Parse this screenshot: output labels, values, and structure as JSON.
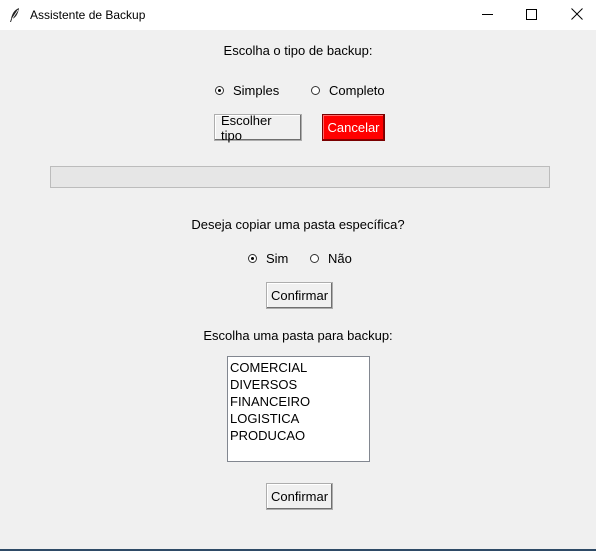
{
  "window": {
    "title": "Assistente de Backup"
  },
  "backup_type": {
    "prompt": "Escolha o tipo de backup:",
    "options": [
      {
        "label": "Simples",
        "selected": true
      },
      {
        "label": "Completo",
        "selected": false
      }
    ],
    "choose_button": "Escolher tipo",
    "cancel_button": "Cancelar",
    "cancel_color": "#ff0000"
  },
  "progress": {
    "value": 0
  },
  "copy_folder": {
    "prompt": "Deseja copiar uma pasta específica?",
    "options": [
      {
        "label": "Sim",
        "selected": true
      },
      {
        "label": "Não",
        "selected": false
      }
    ],
    "confirm_button": "Confirmar"
  },
  "folder_select": {
    "prompt": "Escolha uma pasta para backup:",
    "folders": [
      "COMERCIAL",
      "DIVERSOS",
      "FINANCEIRO",
      "LOGISTICA",
      "PRODUCAO"
    ],
    "confirm_button": "Confirmar"
  },
  "icons": {
    "app": "feather-icon",
    "minimize": "minimize-icon",
    "maximize": "maximize-icon",
    "close": "close-icon"
  }
}
